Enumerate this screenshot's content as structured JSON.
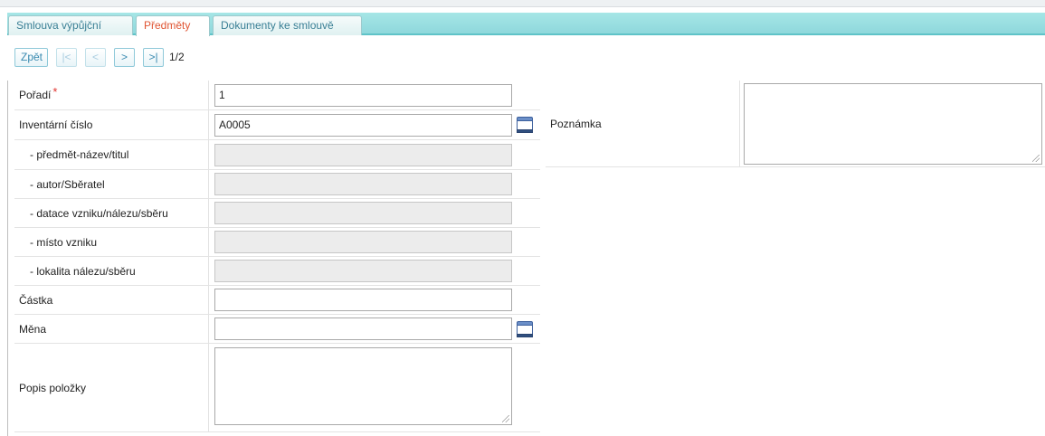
{
  "tabs": [
    {
      "label": "Smlouva výpůjční",
      "active": false
    },
    {
      "label": "Předměty",
      "active": true
    },
    {
      "label": "Dokumenty ke smlouvě",
      "active": false
    }
  ],
  "toolbar": {
    "back_label": "Zpět",
    "first_label": "|<",
    "prev_label": "<",
    "next_label": ">",
    "last_label": ">|",
    "pager_text": "1/2"
  },
  "form": {
    "poradi": {
      "label": "Pořadí",
      "required_mark": "*",
      "value": "1"
    },
    "inventarni_cislo": {
      "label": "Inventární číslo",
      "value": "A0005"
    },
    "predmet_nazev": {
      "label": "- předmět-název/titul",
      "value": ""
    },
    "autor": {
      "label": "- autor/Sběratel",
      "value": ""
    },
    "datace": {
      "label": "- datace vzniku/nálezu/sběru",
      "value": ""
    },
    "misto": {
      "label": "- místo vzniku",
      "value": ""
    },
    "lokalita": {
      "label": "- lokalita nálezu/sběru",
      "value": ""
    },
    "castka": {
      "label": "Částka",
      "value": ""
    },
    "mena": {
      "label": "Měna",
      "value": ""
    },
    "popis": {
      "label": "Popis položky",
      "value": ""
    },
    "poznamka": {
      "label": "Poznámka",
      "value": ""
    }
  },
  "colors": {
    "tabbar": "#8fd8dc",
    "active_tab_text": "#e05533",
    "tab_text": "#3a7f95",
    "required": "#e0332f"
  },
  "icons": {
    "lookup": "lookup-list-icon",
    "resize": "resize-grip-icon"
  }
}
